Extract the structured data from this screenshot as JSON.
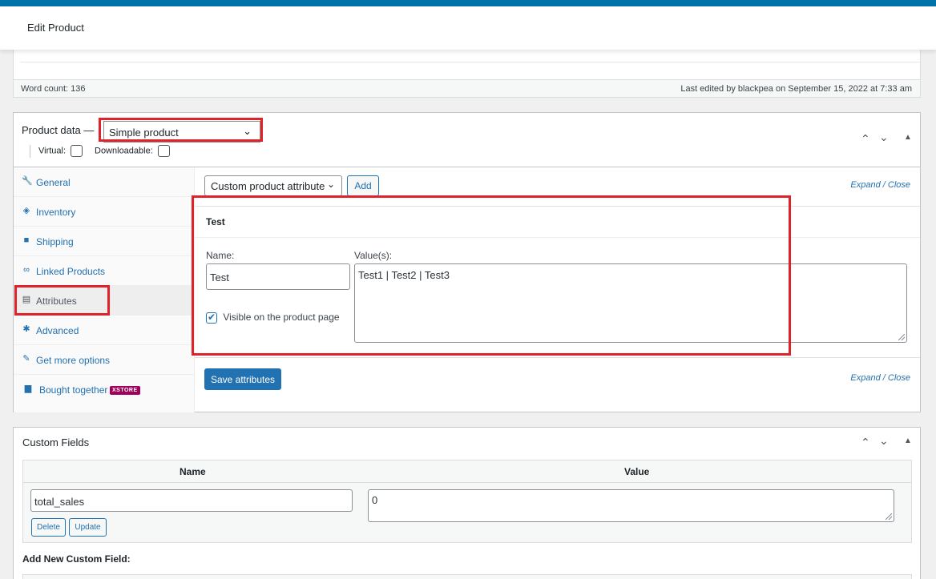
{
  "header": {
    "title": "Edit Product"
  },
  "editor_status": {
    "word_count": "Word count: 136",
    "last_edited": "Last edited by blackpea on September 15, 2022 at 7:33 am"
  },
  "product_data": {
    "label": "Product data —",
    "type_selected": "Simple product",
    "virtual_label": "Virtual:",
    "downloadable_label": "Downloadable:",
    "tabs": [
      {
        "label": "General",
        "icon": "wrench-icon"
      },
      {
        "label": "Inventory",
        "icon": "tag-icon"
      },
      {
        "label": "Shipping",
        "icon": "truck-icon"
      },
      {
        "label": "Linked Products",
        "icon": "link-icon"
      },
      {
        "label": "Attributes",
        "icon": "table-icon"
      },
      {
        "label": "Advanced",
        "icon": "gear-icon"
      },
      {
        "label": "Get more options",
        "icon": "plugin-icon"
      },
      {
        "label": "Bought together",
        "icon": "bag-icon",
        "badge": "XSTORE"
      }
    ],
    "active_tab": "Attributes",
    "attributes": {
      "select_value": "Custom product attribute",
      "add_label": "Add",
      "expand_label": "Expand",
      "separator": "/",
      "close_label": "Close",
      "attribute_title": "Test",
      "name_label": "Name:",
      "name_value": "Test",
      "values_label": "Value(s):",
      "values_value": "Test1 | Test2 | Test3",
      "visible_label": "Visible on the product page",
      "visible_checked": true,
      "save_label": "Save attributes"
    }
  },
  "custom_fields": {
    "title": "Custom Fields",
    "col_name": "Name",
    "col_value": "Value",
    "row_name": "total_sales",
    "row_value": "0",
    "delete_label": "Delete",
    "update_label": "Update",
    "add_new_label": "Add New Custom Field:"
  },
  "colors": {
    "accent": "#2271b1",
    "topbar": "#0073aa",
    "highlight": "#e0222b",
    "badge": "#a0005b"
  }
}
